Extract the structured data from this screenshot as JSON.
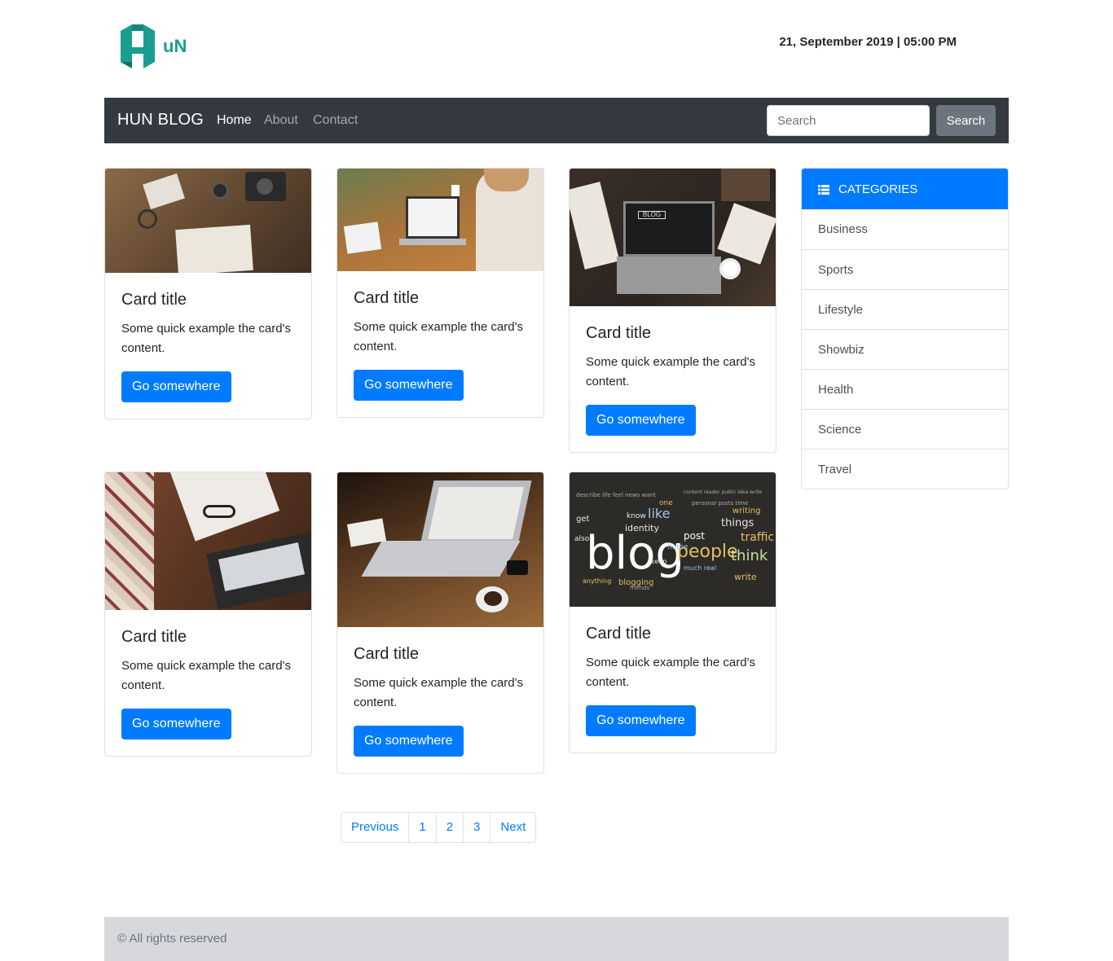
{
  "header": {
    "logo_text": "HuN",
    "datetime": "21, September 2019 | 05:00 PM"
  },
  "navbar": {
    "brand": "HUN BLOG",
    "links": [
      "Home",
      "About",
      "Contact"
    ],
    "active_link": "Home",
    "search_placeholder": "Search",
    "search_button": "Search"
  },
  "cards": [
    {
      "title": "Card title",
      "text": "Some quick example the card's content.",
      "button": "Go somewhere",
      "image": "travel-desk-photo"
    },
    {
      "title": "Card title",
      "text": "Some quick example the card's content.",
      "button": "Go somewhere",
      "image": "woman-laptop-photo"
    },
    {
      "title": "Card title",
      "text": "Some quick example the card's content.",
      "button": "Go somewhere",
      "image": "blog-laptop-photo"
    },
    {
      "title": "Card title",
      "text": "Some quick example the card's content.",
      "button": "Go somewhere",
      "image": "laptop-glasses-photo"
    },
    {
      "title": "Card title",
      "text": "Some quick example the card's content.",
      "button": "Go somewhere",
      "image": "laptop-coffee-photo"
    },
    {
      "title": "Card title",
      "text": "Some quick example the card's content.",
      "button": "Go somewhere",
      "image": "blog-word-cloud"
    }
  ],
  "sidebar": {
    "header": "CATEGORIES",
    "items": [
      "Business",
      "Sports",
      "Lifestyle",
      "Showbiz",
      "Health",
      "Science",
      "Travel"
    ]
  },
  "pagination": {
    "prev": "Previous",
    "pages": [
      "1",
      "2",
      "3"
    ],
    "next": "Next"
  },
  "footer": {
    "text": "© All rights reserved"
  },
  "colors": {
    "primary": "#007bff",
    "navbar": "#343a40",
    "secondary": "#6c757d",
    "footer": "#d6d8db",
    "logo_teal": "#1a9e8f"
  }
}
